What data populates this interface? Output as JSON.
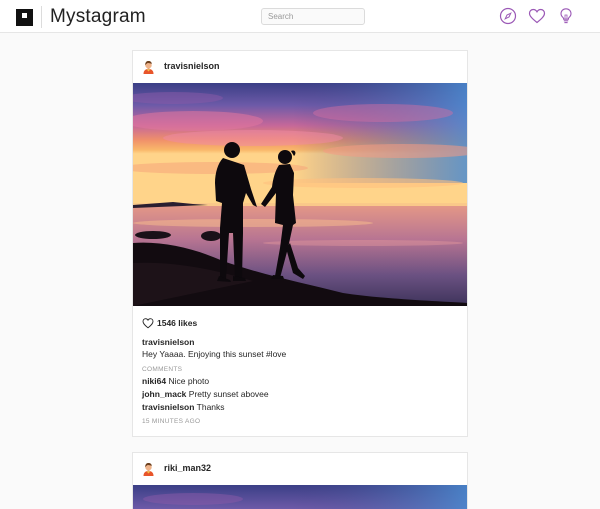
{
  "app": {
    "name": "Mystagram"
  },
  "search": {
    "placeholder": "Search"
  },
  "nav": {
    "icons": [
      "compass-icon",
      "heart-icon",
      "lightbulb-icon"
    ],
    "accent": "#9b59b6"
  },
  "posts": [
    {
      "username": "travisnielson",
      "likes": "1546 likes",
      "caption_user": "travisnielson",
      "caption": "Hey Yaaaa. Enjoying this sunset #love",
      "comments_label": "COMMENTS",
      "comments": [
        {
          "user": "niki64",
          "text": "Nice photo"
        },
        {
          "user": "john_mack",
          "text": "Pretty sunset abovee"
        },
        {
          "user": "travisnielson",
          "text": "Thanks"
        }
      ],
      "timestamp": "15 MINUTES AGO"
    },
    {
      "username": "riki_man32"
    }
  ]
}
